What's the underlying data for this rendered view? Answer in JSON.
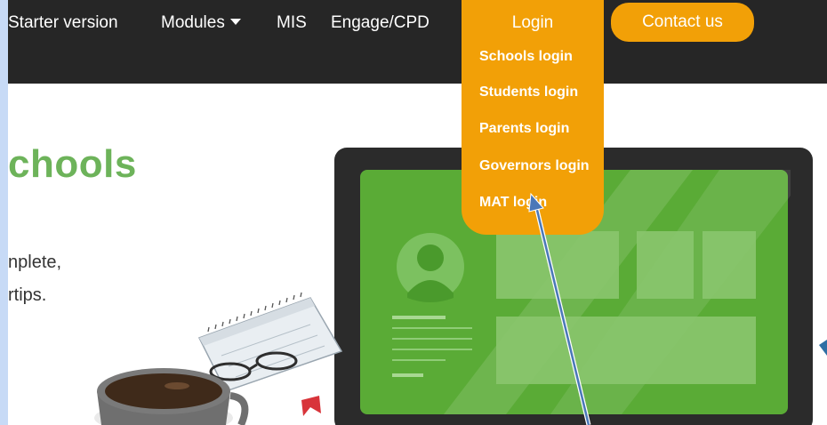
{
  "nav": {
    "items": [
      {
        "label": "Starter version"
      },
      {
        "label": "Modules"
      },
      {
        "label": "MIS"
      },
      {
        "label": "Engage/CPD"
      }
    ],
    "login": {
      "label": "Login",
      "menu": [
        {
          "label": "Schools login"
        },
        {
          "label": "Students login"
        },
        {
          "label": "Parents login"
        },
        {
          "label": "Governors login"
        },
        {
          "label": "MAT login"
        }
      ]
    },
    "contact_label": "Contact us"
  },
  "hero": {
    "title_partial": "chools",
    "line1_partial": "nplete,",
    "line2_partial": "rtips."
  },
  "colors": {
    "navbar": "#262626",
    "accent_orange": "#f2a007",
    "title_green": "#6db35a",
    "screen_green": "#5aab36",
    "annotation_arrow": "#4a78b8",
    "outer_background": "#c7daf6"
  }
}
